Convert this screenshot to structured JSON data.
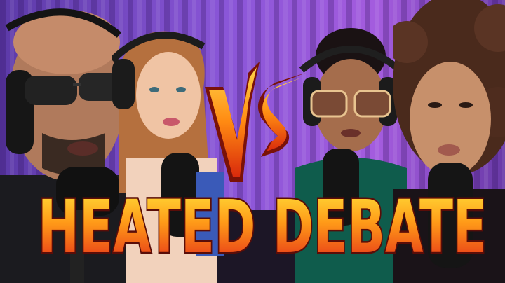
{
  "thumbnail": {
    "headline": "HEATED DEBATE",
    "badge": "VS",
    "colors": {
      "curtain_left": "#7b49c9",
      "curtain_right": "#9c4fd6",
      "text_top": "#ffe03a",
      "text_bottom": "#e3261a",
      "text_outline": "#5a0d08",
      "vs_fire": "#f26a10"
    },
    "people": [
      {
        "label": "man-with-sunglasses"
      },
      {
        "label": "blonde-woman"
      },
      {
        "label": "woman-with-glasses"
      },
      {
        "label": "curly-haired-woman"
      }
    ]
  }
}
